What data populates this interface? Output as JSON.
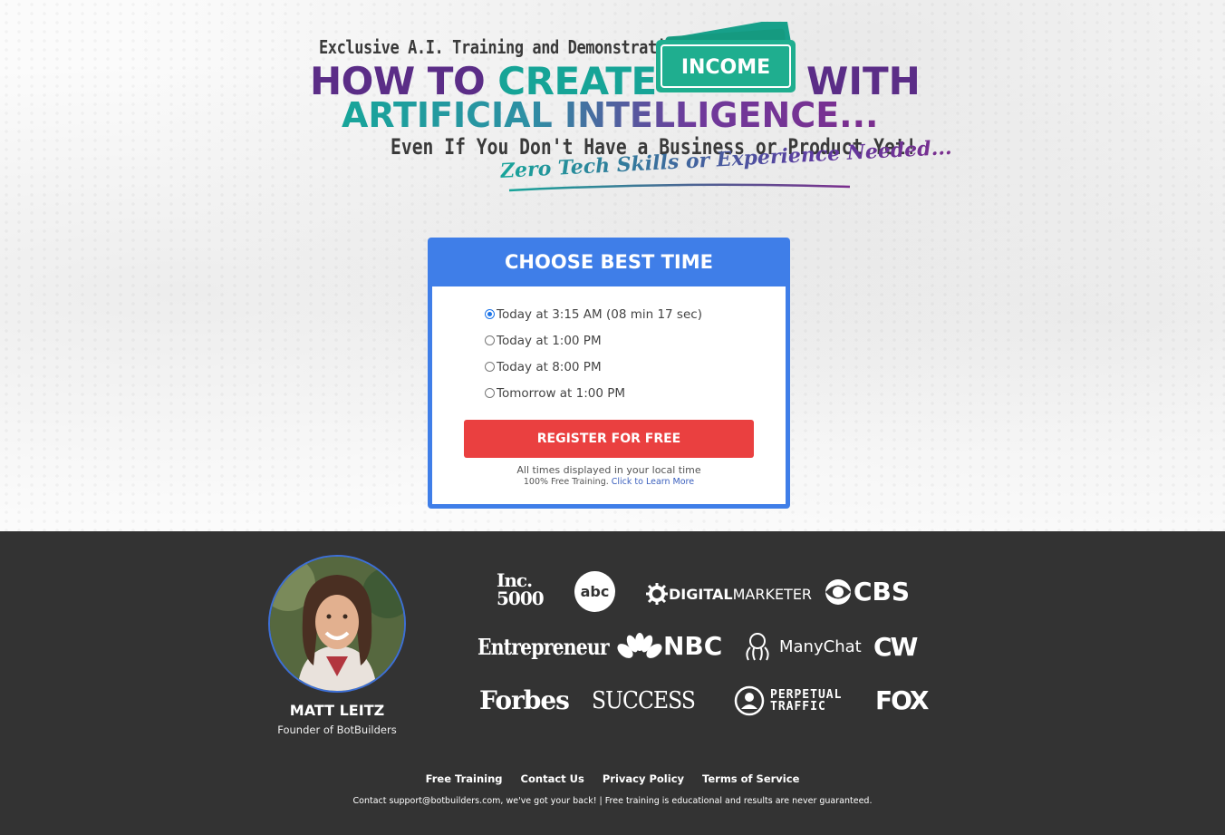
{
  "hero": {
    "kicker": "Exclusive A.I. Training and Demonstration",
    "line1_part1": "HOW TO ",
    "line1_part2": "CREATE",
    "income_badge": "INCOME",
    "line1_part3": "WITH",
    "line2": "ARTIFICIAL INTELLIGENCE...",
    "sub1": "Even If You Don't Have a Business or Product Yet!",
    "sub2": "Zero Tech Skills or Experience Needed...",
    "colors": {
      "purple": "#5b2d87",
      "teal": "#16a497",
      "badge_green": "#1fae8f"
    }
  },
  "form": {
    "title": "CHOOSE BEST TIME",
    "options": [
      {
        "label": "Today at 3:15 AM (08 min 17 sec)",
        "selected": true
      },
      {
        "label": "Today at 1:00 PM",
        "selected": false
      },
      {
        "label": "Today at 8:00 PM",
        "selected": false
      },
      {
        "label": "Tomorrow at 1:00 PM",
        "selected": false
      }
    ],
    "register_label": "REGISTER FOR FREE",
    "note_local_time": "All times displayed in your local time",
    "note_training_prefix": "100% Free Training. ",
    "note_training_link": "Click to Learn More",
    "colors": {
      "accent": "#3f7ee8",
      "button": "#ea4040"
    }
  },
  "footer": {
    "person_name": "MATT LEITZ",
    "person_role": "Founder of BotBuilders",
    "logos": {
      "inc_line1": "Inc.",
      "inc_line2": "5000",
      "abc": "abc",
      "digitalmarketer_bold": "DIGITAL",
      "digitalmarketer_rest": "MARKETER",
      "cbs": "CBS",
      "entrepreneur": "Entrepreneur",
      "nbc": "NBC",
      "manychat": "ManyChat",
      "cw": "CW",
      "forbes": "Forbes",
      "success": "SUCCESS",
      "pt_line1": "PERPETUAL",
      "pt_line2": "TRAFFIC",
      "fox": "FOX"
    },
    "links": [
      "Free Training",
      "Contact Us",
      "Privacy Policy",
      "Terms of Service"
    ],
    "disclaimer": "Contact support@botbuilders.com, we've got your back! | Free training is educational and results are never guaranteed.",
    "background": "#333333"
  }
}
